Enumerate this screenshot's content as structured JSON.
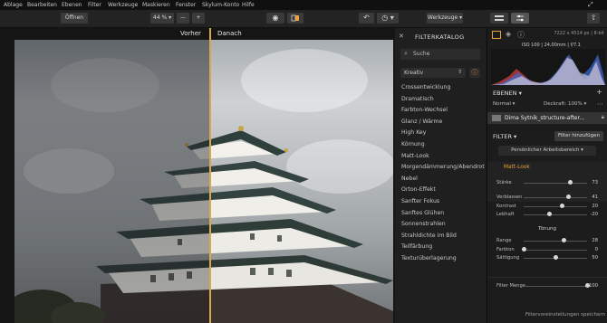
{
  "menu": [
    "Ablage",
    "Bearbeiten",
    "Ebenen",
    "Filter",
    "Werkzeuge",
    "Maskieren",
    "Fenster",
    "Skylum-Konto",
    "Hilfe"
  ],
  "toolbar": {
    "open_label": "Öffnen",
    "zoom": "44 %",
    "zoom_minus": "—",
    "zoom_plus": "+",
    "tools_label": "Werkzeuge"
  },
  "view": {
    "before": "Vorher",
    "after": "Danach"
  },
  "catalog": {
    "title": "FILTERKATALOG",
    "search_placeholder": "Suche",
    "category": "Kreativ",
    "items": [
      "Crossentwicklung",
      "Dramatisch",
      "Farbton-Wechsel",
      "Glanz / Wärme",
      "High Key",
      "Körnung",
      "Matt-Look",
      "Morgendämmerung/Abendrot",
      "Nebel",
      "Orton-Effekt",
      "Sanfter Fokus",
      "Sanftes Glühen",
      "Sonnenstrahlen",
      "Strahldichte im Bild",
      "Teilfärbung",
      "Texturüberlagerung"
    ]
  },
  "info": {
    "dims": "7222 x 4514 px | 8-bit",
    "exif": "ISO 100 | 24,00mm | f/7.1"
  },
  "layers": {
    "title": "EBENEN",
    "mode": "Normal",
    "opacity_label": "Deckraft: 100%",
    "layer_name": "Dima Sytnik_structure-after..."
  },
  "filter": {
    "title": "FILTER",
    "add_button": "Filter hinzufügen",
    "workspace": "Persönlicher Arbeitsbereich",
    "active_filter": "Matt-Look",
    "strength": {
      "label": "Stärke",
      "value": "73",
      "level": 0.73
    },
    "sliders": [
      {
        "label": "Verblassen",
        "value": "41",
        "level": 0.7
      },
      {
        "label": "Kontrast",
        "value": "20",
        "level": 0.6
      },
      {
        "label": "Lebhaft",
        "value": "-20",
        "level": 0.4
      }
    ],
    "tone_title": "Tönung",
    "tone_sliders": [
      {
        "label": "Range",
        "value": "28",
        "level": 0.64
      },
      {
        "label": "Farbton",
        "value": "0",
        "level": 0.0
      },
      {
        "label": "Sättigung",
        "value": "50",
        "level": 0.5
      }
    ],
    "mix": {
      "label": "Filter Menge",
      "value": "100",
      "level": 1.0
    },
    "save_label": "Filtervoreinstellungen speichern"
  },
  "colors": {
    "accent": "#e9a33a",
    "gold_divider": "#d9a84a"
  }
}
